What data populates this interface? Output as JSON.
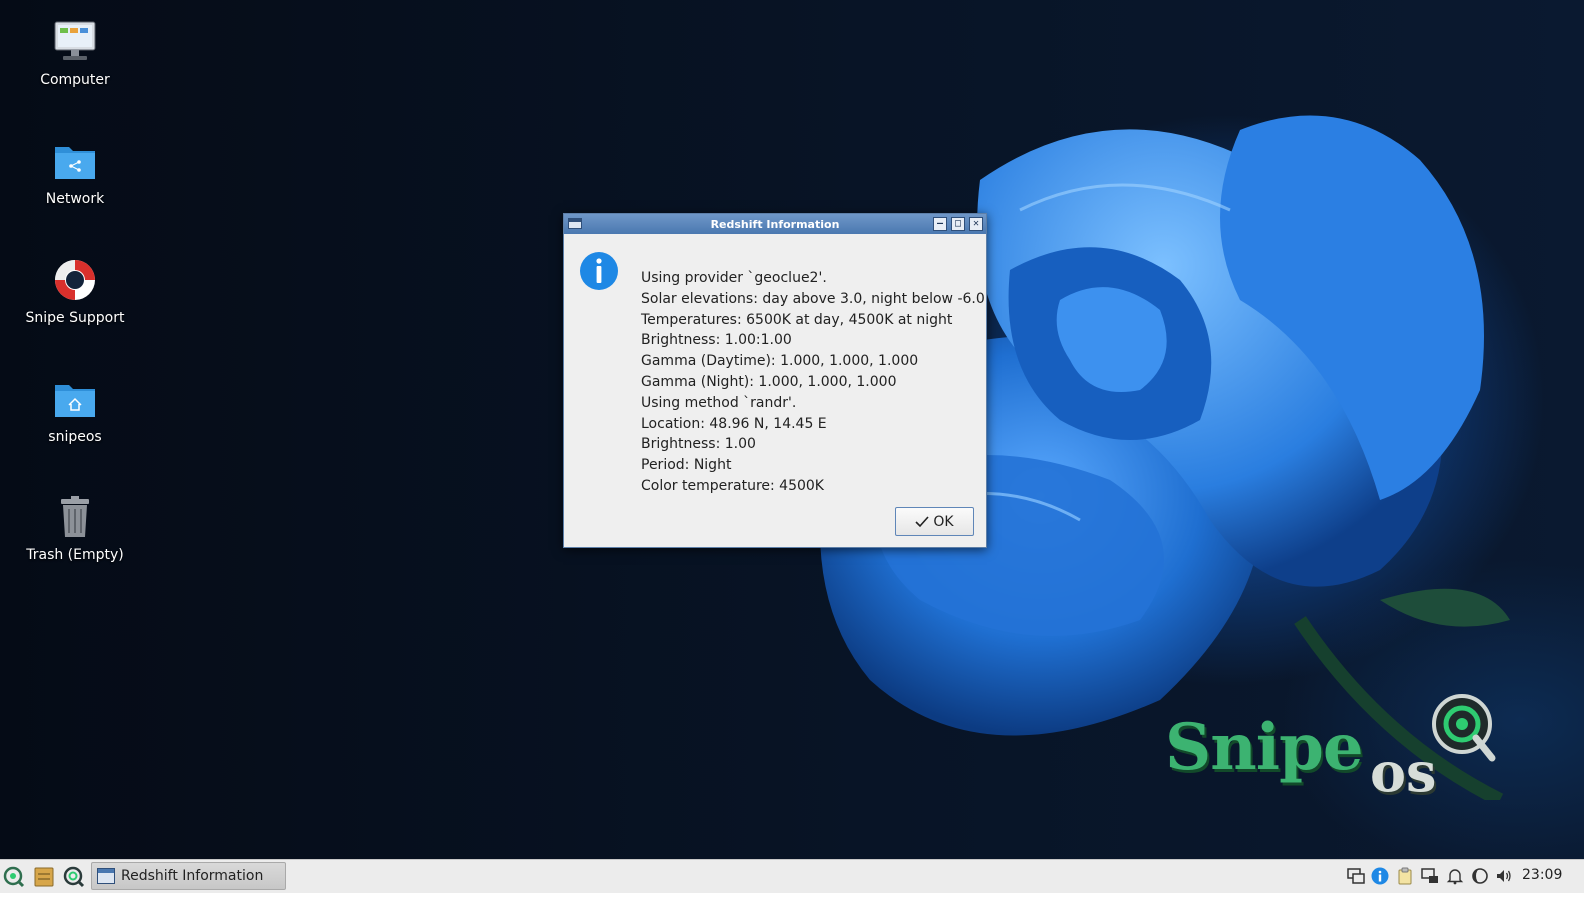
{
  "desktop": {
    "icons": [
      {
        "label": "Computer",
        "icon": "computer-icon"
      },
      {
        "label": "Network",
        "icon": "network-folder-icon"
      },
      {
        "label": "Snipe Support",
        "icon": "lifebuoy-icon"
      },
      {
        "label": "snipeos",
        "icon": "home-folder-icon"
      },
      {
        "label": "Trash (Empty)",
        "icon": "trash-icon"
      }
    ],
    "brand": {
      "name_part1": "Snipe",
      "name_part2": "os"
    }
  },
  "dialog": {
    "title": "Redshift Information",
    "icon": "info-icon",
    "lines": [
      "Using provider `geoclue2'.",
      "Solar elevations: day above 3.0, night below -6.0",
      "Temperatures: 6500K at day, 4500K at night",
      "Brightness: 1.00:1.00",
      "Gamma (Daytime): 1.000, 1.000, 1.000",
      "Gamma (Night): 1.000, 1.000, 1.000",
      "Using method `randr'.",
      "Location: 48.96 N, 14.45 E",
      "Brightness: 1.00",
      "Period: Night",
      "Color temperature: 4500K"
    ],
    "ok_label": "OK",
    "ok_icon": "checkmark-icon"
  },
  "taskbar": {
    "launchers": [
      "snipe-menu-icon",
      "file-manager-icon",
      "snipe-search-icon"
    ],
    "task_title": "Redshift Information",
    "tray_icons": [
      "network-tray-icon",
      "info-tray-icon",
      "clipboard-icon",
      "display-icon",
      "notification-bell-icon",
      "redshift-icon",
      "volume-icon"
    ],
    "clock": "23:09"
  },
  "colors": {
    "accent": "#4a78b0",
    "brand_green": "#3cb371",
    "taskbar": "#ececec"
  }
}
